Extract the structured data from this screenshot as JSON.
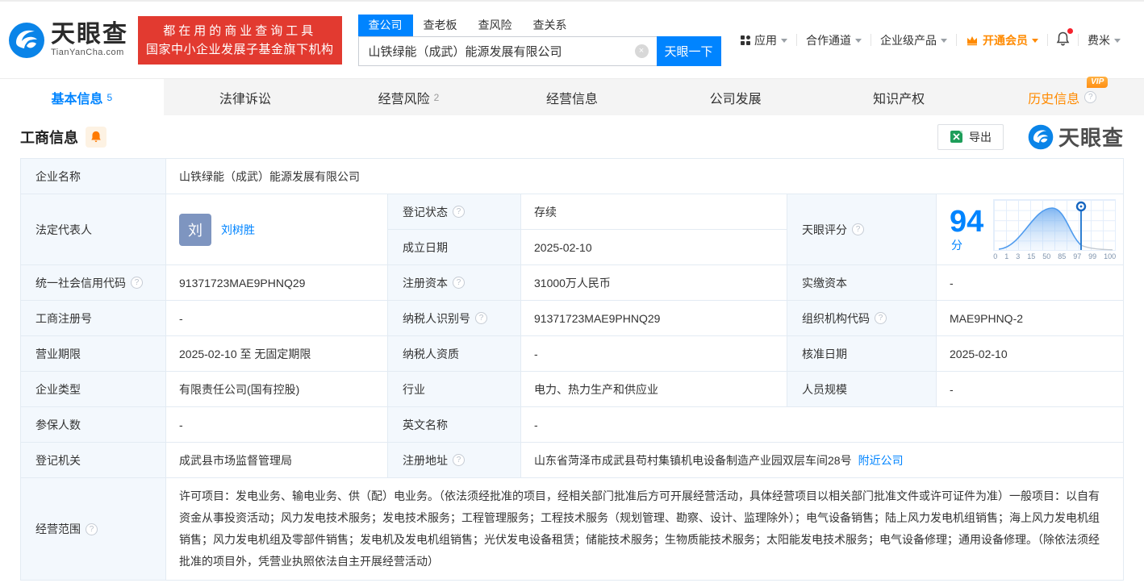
{
  "colors": {
    "primary_blue": "#0084ff",
    "brand_red": "#e23a30",
    "vip_orange": "#ff8a00",
    "status_green": "#2aa147"
  },
  "icons": {
    "help": "?",
    "clear": "×",
    "vip": "VIP"
  },
  "header": {
    "logo": {
      "brand": "天眼查",
      "domain": "TianYanCha.com"
    },
    "slogan": {
      "line1": "都在用的商业查询工具",
      "line2": "国家中小企业发展子基金旗下机构"
    },
    "search": {
      "tabs": [
        {
          "label": "查公司"
        },
        {
          "label": "查老板"
        },
        {
          "label": "查风险"
        },
        {
          "label": "查关系"
        }
      ],
      "value": "山铁绿能（成武）能源发展有限公司",
      "button": "天眼一下"
    },
    "nav": {
      "apps": "应用",
      "partner": "合作通道",
      "enterprise": "企业级产品",
      "vip": "开通会员",
      "user": "费米"
    }
  },
  "tabs": [
    {
      "label": "基本信息",
      "count": "5"
    },
    {
      "label": "法律诉讼",
      "count": ""
    },
    {
      "label": "经营风险",
      "count": "2"
    },
    {
      "label": "经营信息",
      "count": ""
    },
    {
      "label": "公司发展",
      "count": ""
    },
    {
      "label": "知识产权",
      "count": ""
    },
    {
      "label": "历史信息",
      "count": ""
    }
  ],
  "section": {
    "title": "工商信息",
    "export_label": "导出",
    "watermark": "天眼查"
  },
  "fields": {
    "company_name": {
      "label": "企业名称",
      "value": "山铁绿能（成武）能源发展有限公司"
    },
    "legal_rep": {
      "label": "法定代表人",
      "avatar": "刘",
      "value": "刘树胜"
    },
    "reg_status": {
      "label": "登记状态",
      "value": "存续"
    },
    "est_date": {
      "label": "成立日期",
      "value": "2025-02-10"
    },
    "score": {
      "label": "天眼评分"
    },
    "credit_code": {
      "label": "统一社会信用代码",
      "value": "91371723MAE9PHNQ29"
    },
    "reg_capital": {
      "label": "注册资本",
      "value": "31000万人民币"
    },
    "paid_capital": {
      "label": "实缴资本",
      "value": "-"
    },
    "reg_number": {
      "label": "工商注册号",
      "value": "-"
    },
    "taxpayer_id": {
      "label": "纳税人识别号",
      "value": "91371723MAE9PHNQ29"
    },
    "org_code": {
      "label": "组织机构代码",
      "value": "MAE9PHNQ-2"
    },
    "business_term": {
      "label": "营业期限",
      "value": "2025-02-10 至 无固定期限"
    },
    "taxpayer_quality": {
      "label": "纳税人资质",
      "value": "-"
    },
    "approval_date": {
      "label": "核准日期",
      "value": "2025-02-10"
    },
    "company_type": {
      "label": "企业类型",
      "value": "有限责任公司(国有控股)"
    },
    "industry": {
      "label": "行业",
      "value": "电力、热力生产和供应业"
    },
    "staff_size": {
      "label": "人员规模",
      "value": "-"
    },
    "insured_count": {
      "label": "参保人数",
      "value": "-"
    },
    "english_name": {
      "label": "英文名称",
      "value": "-"
    },
    "reg_authority": {
      "label": "登记机关",
      "value": "成武县市场监督管理局"
    },
    "reg_address": {
      "label": "注册地址",
      "value": "山东省菏泽市成武县苟村集镇机电设备制造产业园双层车间28号",
      "link": "附近公司"
    },
    "business_scope": {
      "label": "经营范围",
      "value": "许可项目：发电业务、输电业务、供（配）电业务。（依法须经批准的项目，经相关部门批准后方可开展经营活动，具体经营项目以相关部门批准文件或许可证件为准）一般项目：以自有资金从事投资活动；风力发电技术服务；发电技术服务；工程管理服务；工程技术服务（规划管理、勘察、设计、监理除外）；电气设备销售；陆上风力发电机组销售；海上风力发电机组销售；风力发电机组及零部件销售；发电机及发电机组销售；光伏发电设备租赁；储能技术服务；生物质能技术服务；太阳能发电技术服务；电气设备修理；通用设备修理。（除依法须经批准的项目外，凭营业执照依法自主开展经营活动）"
    }
  },
  "chart_data": {
    "type": "area",
    "title": "天眼评分",
    "score": "94",
    "unit": "分",
    "ticks": [
      "0",
      "1",
      "3",
      "15",
      "50",
      "85",
      "97",
      "99",
      "100"
    ],
    "marker_value": 94
  }
}
